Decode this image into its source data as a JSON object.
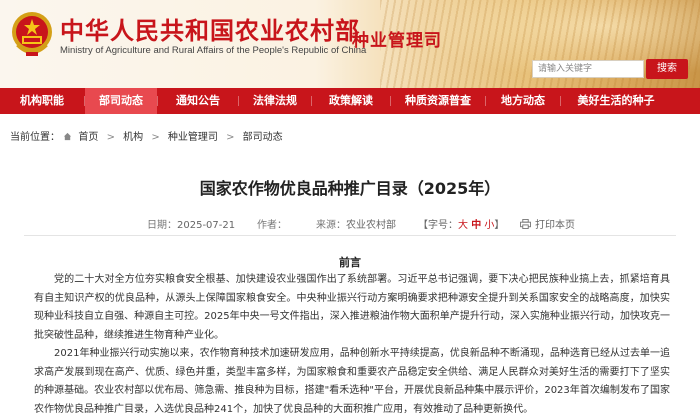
{
  "header": {
    "site_title": "中华人民共和国农业农村部",
    "site_subtitle": "Ministry of Agriculture and Rural Affairs of the People's Republic of China",
    "dept_name": "种业管理司",
    "search_placeholder": "请输入关键字",
    "search_button": "搜索"
  },
  "nav": {
    "items": [
      {
        "label": "机构职能"
      },
      {
        "label": "部司动态",
        "active": true
      },
      {
        "label": "通知公告"
      },
      {
        "label": "法律法规"
      },
      {
        "label": "政策解读"
      },
      {
        "label": "种质资源普查"
      },
      {
        "label": "地方动态"
      },
      {
        "label": "美好生活的种子"
      }
    ]
  },
  "breadcrumb": {
    "prefix": "当前位置：",
    "items": [
      "首页",
      "机构",
      "种业管理司",
      "部司动态"
    ]
  },
  "article": {
    "title": "国家农作物优良品种推广目录（2025年）",
    "meta": {
      "date_label": "日期：",
      "date": "2025-07-21",
      "author_label": "作者：",
      "author": "",
      "source_label": "来源：",
      "source": "农业农村部",
      "font_size_prefix": "【字号：",
      "font_large": "大",
      "font_medium": "中",
      "font_small": "小",
      "font_size_suffix": "】",
      "print_label": "打印本页"
    },
    "section_heading": "前言",
    "paragraphs": [
      "党的二十大对全方位夯实粮食安全根基、加快建设农业强国作出了系统部署。习近平总书记强调，要下决心把民族种业搞上去，抓紧培育具有自主知识产权的优良品种，从源头上保障国家粮食安全。中央种业振兴行动方案明确要求把种源安全提升到关系国家安全的战略高度，加快实现种业科技自立自强、种源自主可控。2025年中央一号文件指出，深入推进粮油作物大面积单产提升行动，深入实施种业振兴行动，加快攻克一批突破性品种，继续推进生物育种产业化。",
      "2021年种业振兴行动实施以来，农作物育种技术加速研发应用，品种创新水平持续提高，优良新品种不断涌现，品种选育已经从过去单一追求高产发展到现在高产、优质、绿色并重，类型丰富多样，为国家粮食和重要农产品稳定安全供给、满足人民群众对美好生活的需要打下了坚实的种源基础。农业农村部以优布局、筛急需、推良种为目标，搭建\"看禾选种\"平台，开展优良新品种集中展示评价，2023年首次编制发布了国家农作物优良品种推广目录，入选优良品种241个，加快了优良品种的大面积推广应用，有效推动了品种更新换代。"
    ]
  },
  "colors": {
    "brand_red": "#c8151b",
    "nav_active": "#e8494f"
  },
  "icons": {
    "emblem": "national-emblem-icon",
    "home": "home-icon",
    "print": "print-icon"
  }
}
